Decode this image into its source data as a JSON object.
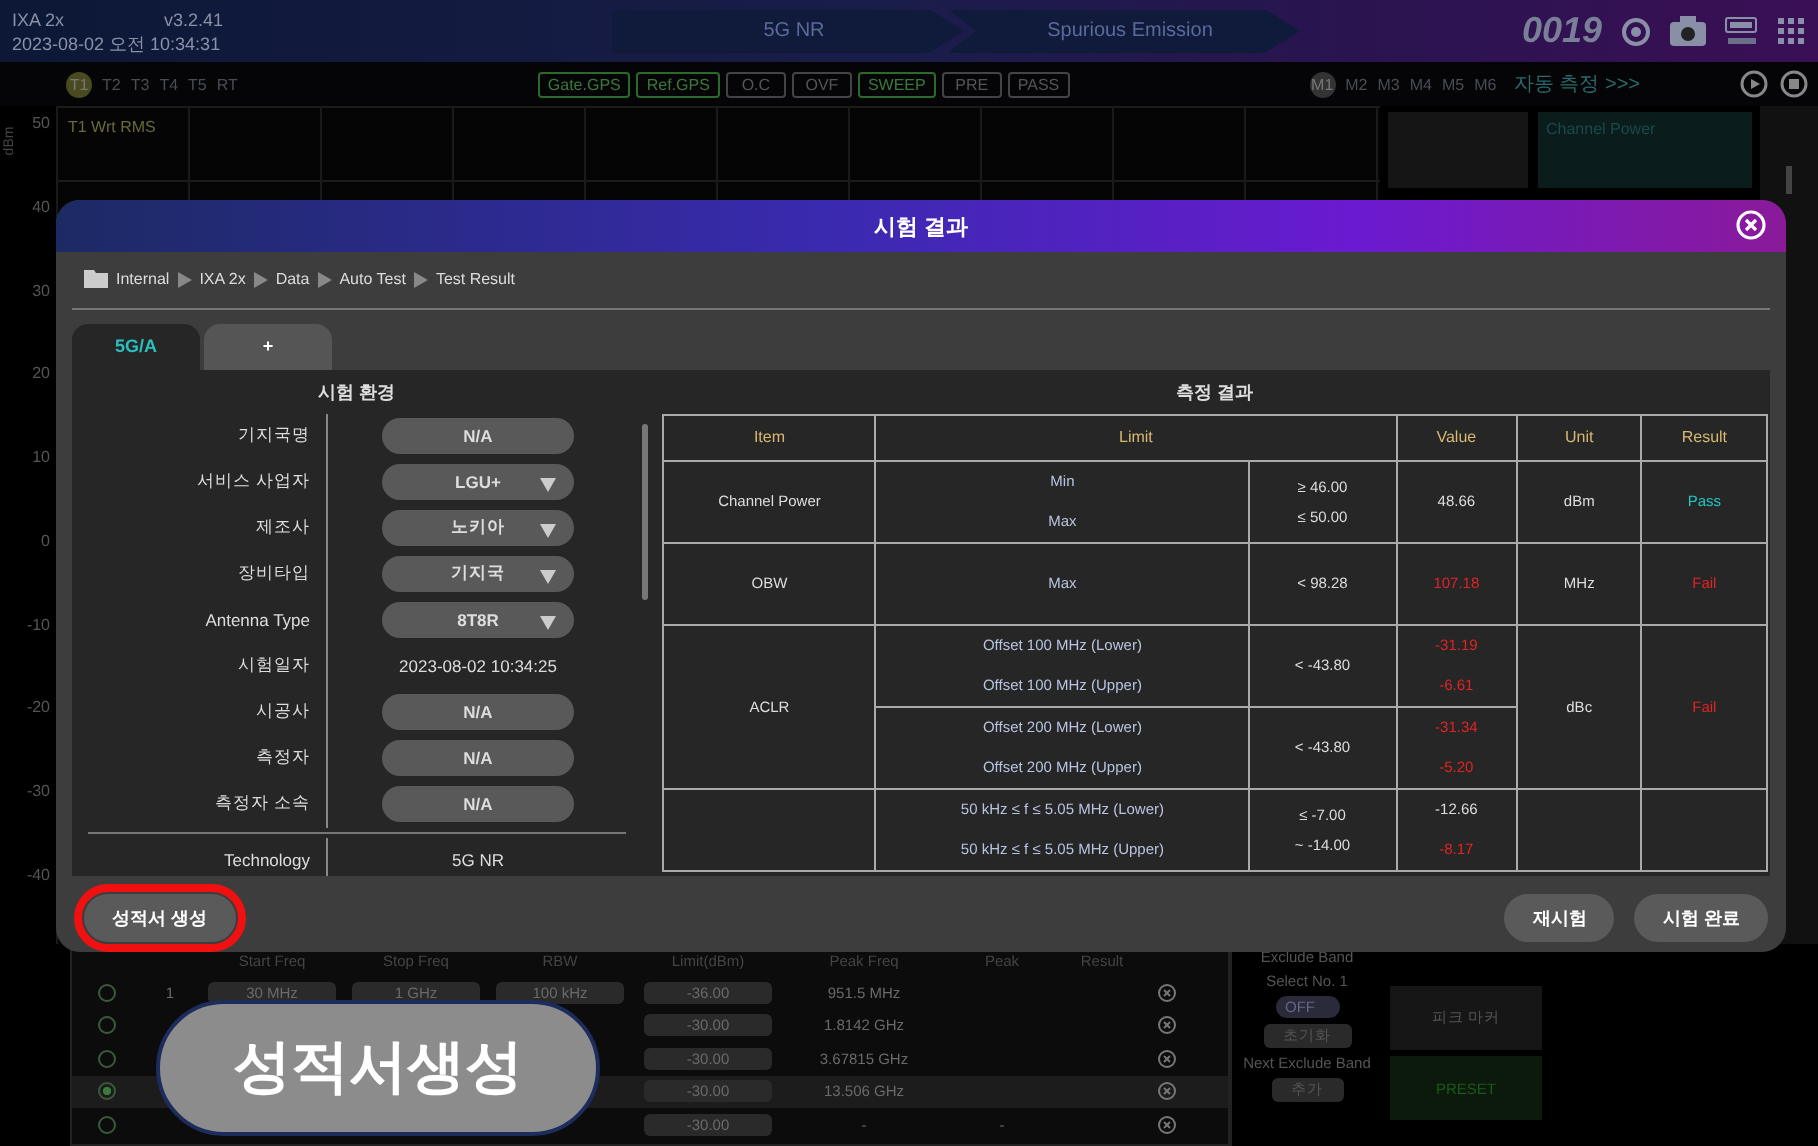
{
  "header": {
    "device": "IXA 2x",
    "version": "v3.2.41",
    "datetime": "2023-08-02 오전 10:34:31",
    "steps": [
      "5G NR",
      "Spurious Emission"
    ],
    "counter": "0019"
  },
  "trace_tabs": [
    {
      "label": "T1",
      "selected": true
    },
    {
      "label": "T2",
      "selected": false
    },
    {
      "label": "T3",
      "selected": false
    },
    {
      "label": "T4",
      "selected": false
    },
    {
      "label": "T5",
      "selected": false
    },
    {
      "label": "RT",
      "selected": false
    }
  ],
  "status_chips": [
    {
      "label": "Gate.GPS",
      "on": true
    },
    {
      "label": "Ref.GPS",
      "on": true
    },
    {
      "label": "O.C",
      "on": false
    },
    {
      "label": "OVF",
      "on": false
    },
    {
      "label": "SWEEP",
      "on": true
    },
    {
      "label": "PRE",
      "on": false
    },
    {
      "label": "PASS",
      "on": false
    }
  ],
  "markers": [
    {
      "label": "M1",
      "selected": true
    },
    {
      "label": "M2",
      "selected": false
    },
    {
      "label": "M3",
      "selected": false
    },
    {
      "label": "M4",
      "selected": false
    },
    {
      "label": "M5",
      "selected": false
    },
    {
      "label": "M6",
      "selected": false
    }
  ],
  "auto_measure": "자동 측정 >>>",
  "chart": {
    "unit": "dBm",
    "trace_label": "T1 Wrt RMS",
    "y_labels": [
      "50",
      "40",
      "30",
      "20",
      "10",
      "0",
      "-10",
      "-20",
      "-30",
      "-40"
    ]
  },
  "side_panel": {
    "measurement": "Channel Power"
  },
  "dialog": {
    "title": "시험 결과",
    "breadcrumb": [
      "Internal",
      "IXA 2x",
      "Data",
      "Auto Test",
      "Test Result"
    ],
    "tabs": [
      {
        "label": "5G/A",
        "selected": true
      },
      {
        "label": "+",
        "selected": false
      }
    ],
    "environment": {
      "title": "시험 환경",
      "rows": [
        {
          "label": "기지국명",
          "value": "N/A",
          "kind": "field"
        },
        {
          "label": "서비스 사업자",
          "value": "LGU+",
          "kind": "select"
        },
        {
          "label": "제조사",
          "value": "노키아",
          "kind": "select"
        },
        {
          "label": "장비타입",
          "value": "기지국",
          "kind": "select"
        },
        {
          "label": "Antenna Type",
          "value": "8T8R",
          "kind": "select"
        },
        {
          "label": "시험일자",
          "value": "2023-08-02 10:34:25",
          "kind": "text"
        },
        {
          "label": "시공사",
          "value": "N/A",
          "kind": "field"
        },
        {
          "label": "측정자",
          "value": "N/A",
          "kind": "field"
        },
        {
          "label": "측정자 소속",
          "value": "N/A",
          "kind": "field"
        }
      ],
      "footer_row": {
        "label": "Technology",
        "value": "5G NR"
      }
    },
    "results": {
      "title": "측정 결과",
      "columns": [
        "Item",
        "Limit",
        "Value",
        "Unit",
        "Result"
      ],
      "groups": [
        {
          "item": "Channel Power",
          "unit": "dBm",
          "result": {
            "text": "Pass",
            "pass": true
          },
          "subs": [
            {
              "labels": [
                "Min",
                "Max"
              ],
              "limits": [
                "≥ 46.00",
                "≤ 50.00"
              ],
              "values": [
                {
                  "text": "48.66",
                  "fail": false
                }
              ]
            }
          ]
        },
        {
          "item": "OBW",
          "unit": "MHz",
          "result": {
            "text": "Fail",
            "pass": false
          },
          "subs": [
            {
              "labels": [
                "Max"
              ],
              "limits": [
                "< 98.28"
              ],
              "values": [
                {
                  "text": "107.18",
                  "fail": true
                }
              ]
            }
          ]
        },
        {
          "item": "ACLR",
          "unit": "dBc",
          "result": {
            "text": "Fail",
            "pass": false
          },
          "subs": [
            {
              "labels": [
                "Offset 100 MHz (Lower)",
                "Offset 100 MHz (Upper)"
              ],
              "limits": [
                "< -43.80"
              ],
              "values": [
                {
                  "text": "-31.19",
                  "fail": true
                },
                {
                  "text": "-6.61",
                  "fail": true
                }
              ]
            },
            {
              "labels": [
                "Offset 200 MHz (Lower)",
                "Offset 200 MHz (Upper)"
              ],
              "limits": [
                "< -43.80"
              ],
              "values": [
                {
                  "text": "-31.34",
                  "fail": true
                },
                {
                  "text": "-5.20",
                  "fail": true
                }
              ]
            }
          ]
        },
        {
          "subs": [
            {
              "labels": [
                "50 kHz ≤ f ≤ 5.05 MHz (Lower)",
                "50 kHz ≤ f ≤ 5.05 MHz (Upper)"
              ],
              "limits": [
                "≤ -7.00",
                "~ -14.00"
              ],
              "values": [
                {
                  "text": "-12.66",
                  "fail": false
                },
                {
                  "text": "-8.17",
                  "fail": true
                }
              ]
            }
          ]
        }
      ]
    },
    "left_button": {
      "label": "성적서 생성",
      "highlighted": true
    },
    "right_buttons": [
      "재시험",
      "시험 완료"
    ]
  },
  "spur_table": {
    "columns": [
      "Start Freq",
      "Stop Freq",
      "RBW",
      "Limit(dBm)",
      "Peak Freq",
      "Peak",
      "Result"
    ],
    "rows": [
      {
        "selected": false,
        "no": "1",
        "start": "30 MHz",
        "stop": "1 GHz",
        "rbw": "100 kHz",
        "limit": "-36.00",
        "peak_freq": "951.5 MHz"
      },
      {
        "selected": false,
        "limit": "-30.00",
        "peak_freq": "1.8142 GHz"
      },
      {
        "selected": false,
        "limit": "-30.00",
        "peak_freq": "3.67815 GHz"
      },
      {
        "selected": true,
        "limit": "-30.00",
        "peak_freq": "13.506 GHz"
      },
      {
        "selected": false,
        "limit": "-30.00",
        "peak_freq": "-",
        "peak": "-"
      }
    ]
  },
  "exclude_band": {
    "title": "Exclude Band",
    "select_label": "Select No. 1",
    "toggle": {
      "label": "OFF",
      "on": false
    },
    "reset": "초기화",
    "next_label": "Next Exclude Band",
    "add": "추가"
  },
  "side_buttons": [
    "피크 마커",
    "PRESET"
  ],
  "callout": "성적서생성"
}
